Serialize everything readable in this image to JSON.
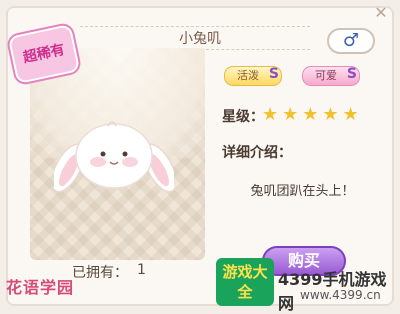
{
  "header": {
    "title": "小兔叽",
    "close_icon": "close-icon",
    "gender_symbol": "♂"
  },
  "rarity": {
    "label": "超稀有"
  },
  "traits": [
    {
      "label": "活泼",
      "grade": "S"
    },
    {
      "label": "可爱",
      "grade": "S"
    }
  ],
  "details": {
    "stars_label": "星级：",
    "stars": "★★★★★",
    "stars_count": 5,
    "intro_label": "详细介绍：",
    "intro_text": "兔叽团趴在头上！"
  },
  "ownership": {
    "label": "已拥有：",
    "value": "1"
  },
  "actions": {
    "buy_label": "购买"
  },
  "branding": {
    "logo_text": "花语学园"
  },
  "watermark": {
    "logo_text": "游戏大全",
    "site_name": "4399手机游戏网",
    "url": "www.4399.cn"
  },
  "colors": {
    "accent": "#9a5bd4",
    "star": "#f2c12e",
    "rarity": "#d02e8c"
  }
}
